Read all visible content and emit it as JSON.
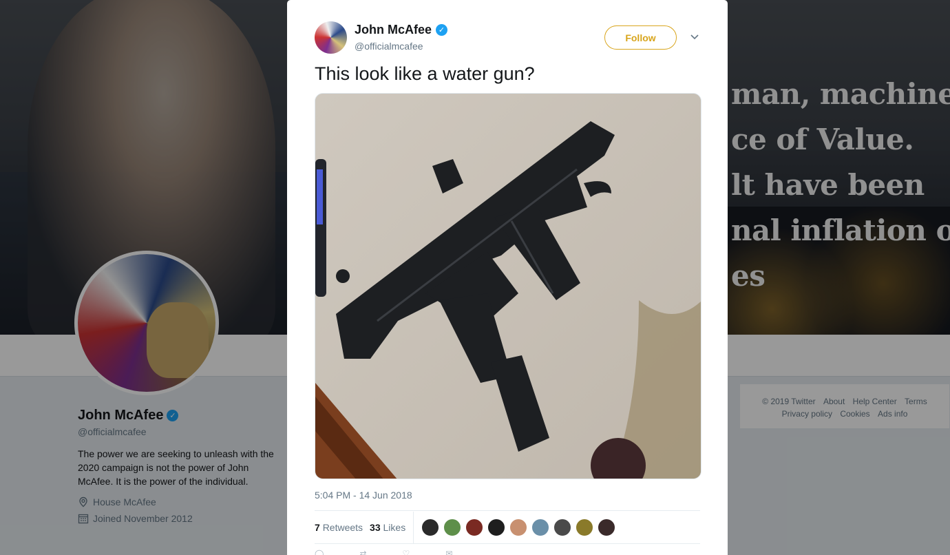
{
  "background": {
    "banner_text_lines": [
      "man, machine,",
      "ce of Value.",
      "lt have been",
      "nal inflation of",
      "es"
    ],
    "profile": {
      "name": "John McAfee",
      "handle": "@officialmcafee",
      "bio": "The power we are seeking to unleash with the 2020 campaign is not the power of John McAfee. It is the power of the individual.",
      "location": "House McAfee",
      "joined": "Joined November 2012"
    },
    "footer": {
      "row1": [
        "© 2019 Twitter",
        "About",
        "Help Center",
        "Terms"
      ],
      "row2": [
        "Privacy policy",
        "Cookies",
        "Ads info"
      ]
    }
  },
  "tweet": {
    "author_name": "John McAfee",
    "author_handle": "@officialmcafee",
    "follow_label": "Follow",
    "text": "This look like a water gun?",
    "timestamp": "5:04 PM - 14 Jun 2018",
    "retweets_count": "7",
    "retweets_label": "Retweets",
    "likes_count": "33",
    "likes_label": "Likes",
    "liker_colors": [
      "#2a2a2a",
      "#5e8f4a",
      "#7a2a22",
      "#1e1e1e",
      "#c89070",
      "#6a8fa8",
      "#4a4a4a",
      "#8a7a2a",
      "#3a2a2a"
    ]
  },
  "colors": {
    "follow_accent": "#d8a51c",
    "verified": "#1da1f2"
  }
}
